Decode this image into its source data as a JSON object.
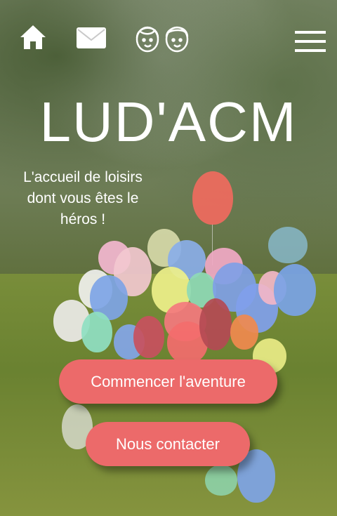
{
  "header": {
    "icons": [
      "home-icon",
      "mail-icon",
      "kids-icon",
      "menu-icon"
    ]
  },
  "hero": {
    "title": "LUD'ACM",
    "tagline": "L'accueil de loisirs dont vous êtes le héros !"
  },
  "actions": {
    "start_label": "Commencer l'aventure",
    "contact_label": "Nous contacter"
  },
  "colors": {
    "button": "#ec6a6a",
    "text": "#ffffff"
  }
}
